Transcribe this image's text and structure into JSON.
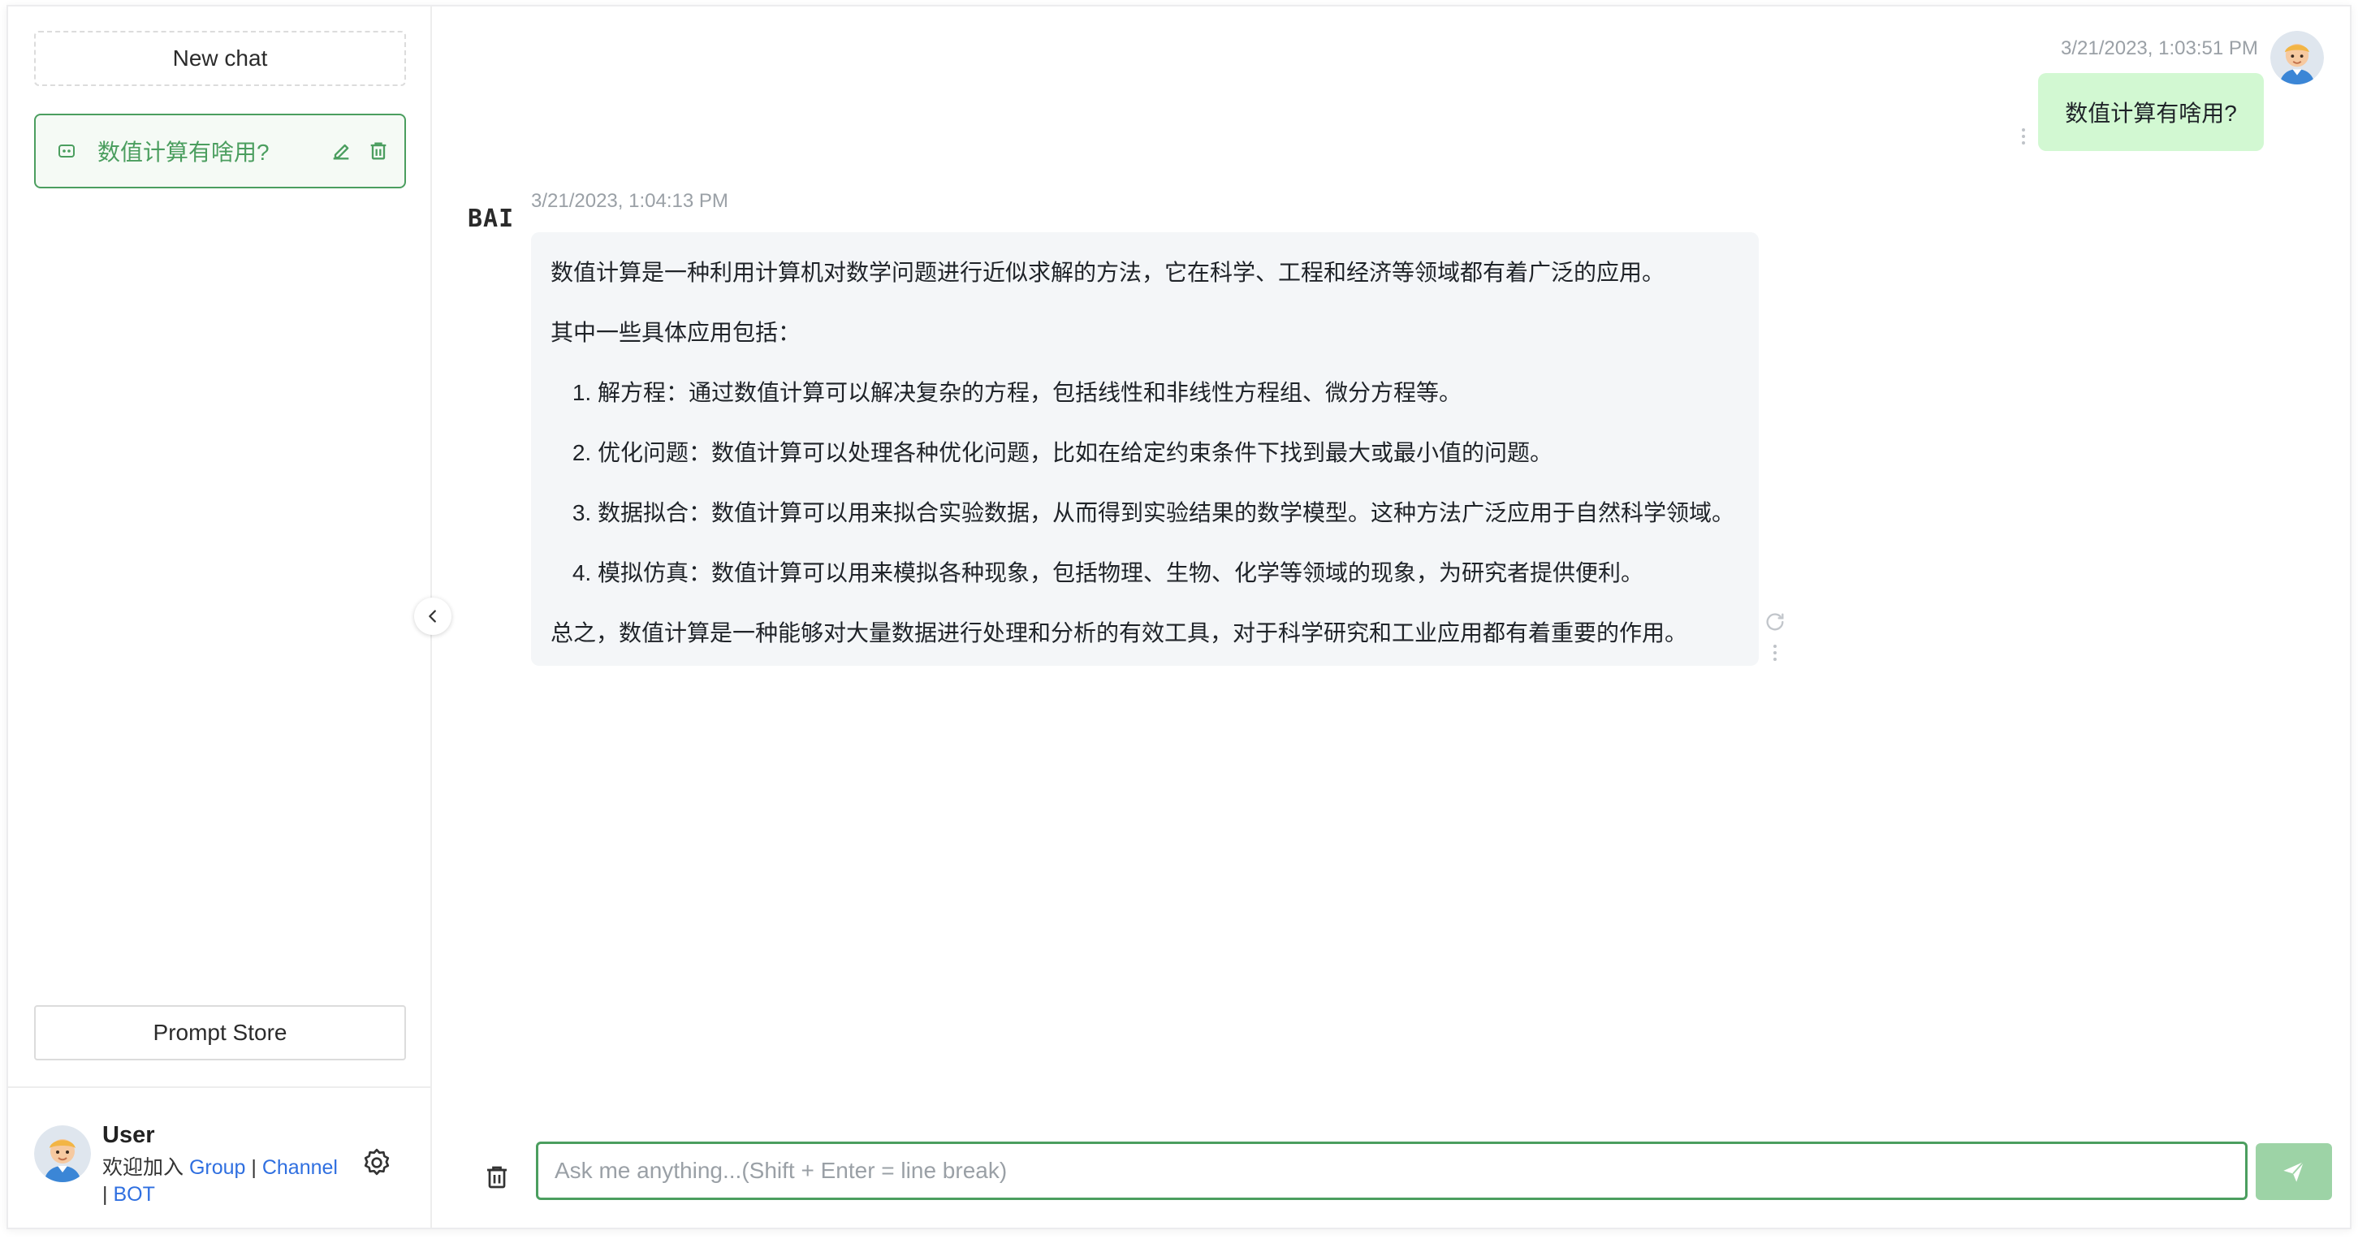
{
  "sidebar": {
    "new_chat_label": "New chat",
    "chats": [
      {
        "title": "数值计算有啥用?"
      }
    ],
    "prompt_store_label": "Prompt Store",
    "user": {
      "name": "User",
      "welcome_prefix": "欢迎加入 ",
      "group_link": "Group",
      "sep1": " | ",
      "channel_link": "Channel",
      "sep2": "| ",
      "bot_link": "BOT"
    }
  },
  "messages": [
    {
      "role": "user",
      "timestamp": "3/21/2023, 1:03:51 PM",
      "text": "数值计算有啥用?"
    },
    {
      "role": "bot",
      "logo": "BAI",
      "timestamp": "3/21/2023, 1:04:13 PM",
      "intro": "数值计算是一种利用计算机对数学问题进行近似求解的方法，它在科学、工程和经济等领域都有着广泛的应用。",
      "list_heading": "其中一些具体应用包括：",
      "items": [
        "解方程：通过数值计算可以解决复杂的方程，包括线性和非线性方程组、微分方程等。",
        "优化问题：数值计算可以处理各种优化问题，比如在给定约束条件下找到最大或最小值的问题。",
        "数据拟合：数值计算可以用来拟合实验数据，从而得到实验结果的数学模型。这种方法广泛应用于自然科学领域。",
        "模拟仿真：数值计算可以用来模拟各种现象，包括物理、生物、化学等领域的现象，为研究者提供便利。"
      ],
      "conclusion": "总之，数值计算是一种能够对大量数据进行处理和分析的有效工具，对于科学研究和工业应用都有着重要的作用。"
    }
  ],
  "input": {
    "placeholder": "Ask me anything...(Shift + Enter = line break)",
    "value": ""
  },
  "colors": {
    "accent": "#4b9e5f",
    "user_bubble": "#d2f8d2",
    "bot_bubble": "#f4f6f8",
    "send_button": "#9dd3a6",
    "link": "#2f6fe0"
  },
  "icons": {
    "chat_item": "message-square-icon",
    "edit": "pencil-icon",
    "delete": "trash-icon",
    "settings": "gear-icon",
    "collapse": "chevron-left-icon",
    "regenerate": "refresh-icon",
    "more": "more-vertical-icon",
    "clear": "trash-icon",
    "send": "send-icon"
  }
}
